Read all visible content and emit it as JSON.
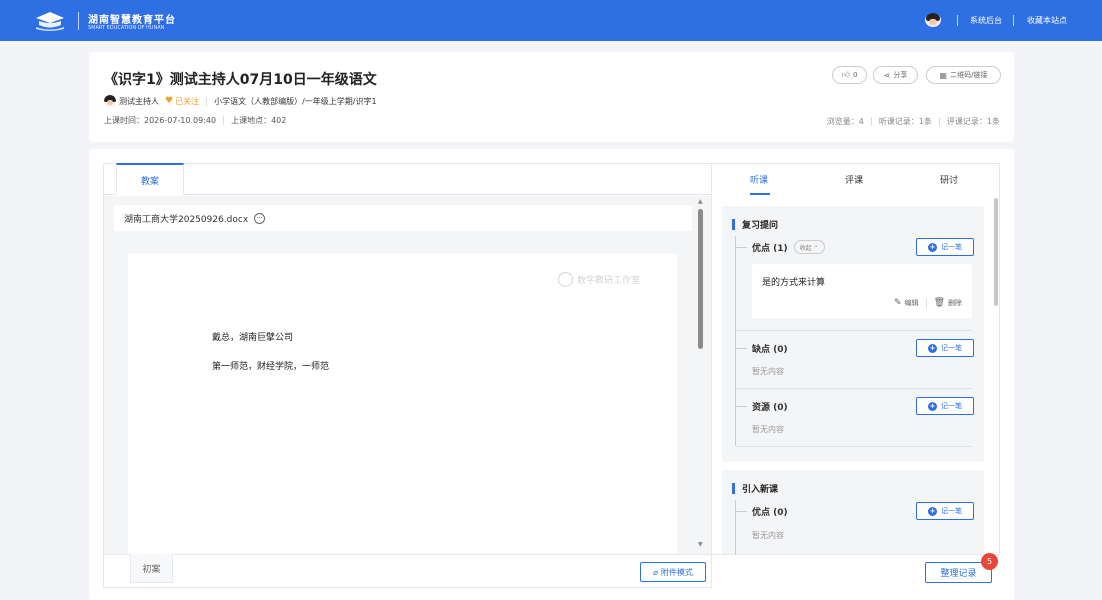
{
  "topbar": {
    "site_name": "湖南智慧教育平台",
    "site_name_en": "SMART EDUCATION OF HUNAN",
    "admin_link": "系统后台",
    "bookmark_link": "收藏本站点"
  },
  "header": {
    "title": "《识字1》测试主持人07月10日一年级语文",
    "host_name": "测试主持人",
    "follow_label": "已关注",
    "course_path": "小学语文（人教部编版）/一年级上学期/识字1",
    "time_label": "上课时间：2026-07-10 09:40",
    "place_label": "上课地点：402",
    "like_count": "0",
    "share_label": "分享",
    "qr_label": "二维码/链接",
    "views_label": "浏览量：4",
    "listen_records_label": "听课记录：1条",
    "review_records_label": "评课记录：1条"
  },
  "left": {
    "tab_label": "教案",
    "file_name": "湖南工商大学20250926.docx",
    "more_glyph": "···",
    "watermark": "数字教研工作室",
    "doc_lines": [
      "戴总，湖南巨擘公司",
      "第一师范，财经学院，一师范"
    ],
    "draft_tab": "初案",
    "attach_mode": "附件模式"
  },
  "right": {
    "tabs": [
      "听课",
      "评课",
      "研讨"
    ],
    "sections": [
      {
        "title": "复习提问",
        "items": [
          {
            "label": "优点 (1)",
            "collapse": "收起 ⌃",
            "note_text": "是的方式来计算",
            "edit": "编辑",
            "delete": "删除"
          },
          {
            "label": "缺点 (0)",
            "empty": "暂无内容"
          },
          {
            "label": "资源 (0)",
            "empty": "暂无内容"
          }
        ]
      },
      {
        "title": "引入新课",
        "items": [
          {
            "label": "优点 (0)",
            "empty": "暂无内容"
          }
        ]
      }
    ],
    "note_button": "记一笔",
    "organize_button": "整理记录",
    "badge_count": "5"
  }
}
